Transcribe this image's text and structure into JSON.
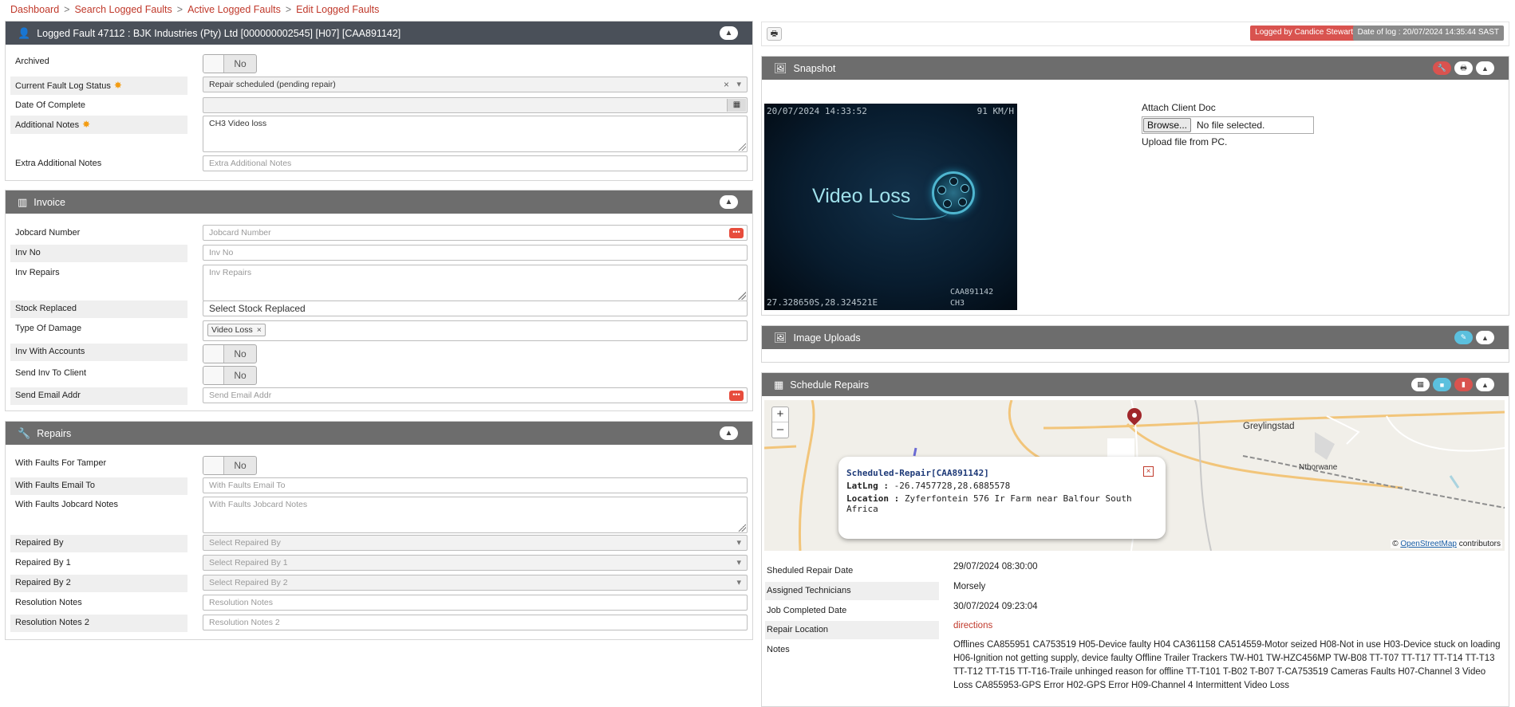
{
  "breadcrumb": [
    "Dashboard",
    "Search Logged Faults",
    "Active Logged Faults",
    "Edit Logged Faults"
  ],
  "breadcrumb_sep": ">",
  "fault": {
    "header_title": "Logged Fault 47112 : BJK Industries (Pty) Ltd [000000002545] [H07] [CAA891142]",
    "archived_label": "Archived",
    "archived_toggle": "No",
    "status_label": "Current Fault Log Status",
    "status_value": "Repair scheduled (pending repair)",
    "clear_glyph": "×",
    "doc_label": "Date Of Complete",
    "notes_label": "Additional Notes",
    "notes_value": "CH3 Video loss",
    "extra_label": "Extra Additional Notes",
    "extra_placeholder": "Extra Additional Notes"
  },
  "invoice": {
    "title": "Invoice",
    "jobcard_label": "Jobcard Number",
    "jobcard_placeholder": "Jobcard Number",
    "invno_label": "Inv No",
    "invno_placeholder": "Inv No",
    "repairs_label": "Inv Repairs",
    "repairs_placeholder": "Inv Repairs",
    "stock_label": "Stock Replaced",
    "stock_value": "Select Stock Replaced",
    "damage_label": "Type Of Damage",
    "damage_tag": "Video Loss",
    "accounts_label": "Inv With Accounts",
    "accounts_toggle": "No",
    "send_label": "Send Inv To Client",
    "send_toggle": "No",
    "email_label": "Send Email Addr",
    "email_placeholder": "Send Email Addr"
  },
  "repairs": {
    "title": "Repairs",
    "tamper_label": "With Faults For Tamper",
    "tamper_toggle": "No",
    "email_to_label": "With Faults Email To",
    "email_to_placeholder": "With Faults Email To",
    "jobcard_notes_label": "With Faults Jobcard Notes",
    "jobcard_notes_placeholder": "With Faults Jobcard Notes",
    "by_label": "Repaired By",
    "by_placeholder": "Select Repaired By",
    "by1_label": "Repaired By 1",
    "by1_placeholder": "Select Repaired By 1",
    "by2_label": "Repaired By 2",
    "by2_placeholder": "Select Repaired By 2",
    "res_label": "Resolution Notes",
    "res_placeholder": "Resolution Notes",
    "res2_label": "Resolution Notes 2",
    "res2_placeholder": "Resolution Notes 2"
  },
  "topbar": {
    "logged_by": "Logged by Candice Stewart",
    "date_of_log": "Date of log : 20/07/2024 14:35:44 SAST"
  },
  "snapshot": {
    "title": "Snapshot",
    "timestamp": "20/07/2024 14:33:52",
    "speed": "91 KM/H",
    "overlay_text": "Video Loss",
    "gps": "27.328650S,28.324521E",
    "camera_id": "CAA891142",
    "channel": "CH3",
    "attach_label": "Attach Client Doc",
    "browse_label": "Browse...",
    "file_status": "No file selected.",
    "upload_label": "Upload file from PC."
  },
  "image_uploads": {
    "title": "Image Uploads"
  },
  "schedule": {
    "title": "Schedule Repairs",
    "zoom_in": "+",
    "zoom_out": "–",
    "town1": "Greylingstad",
    "town2": "Nthorwane",
    "popup_title": "Scheduled-Repair[CAA891142]",
    "popup_latlng_label": "LatLng :",
    "popup_latlng": "-26.7457728,28.6885578",
    "popup_location_label": "Location :",
    "popup_location": "Zyferfontein 576 Ir Farm near Balfour South Africa",
    "popup_close": "×",
    "attribution_prefix": "©",
    "attribution_link": "OpenStreetMap",
    "attribution_suffix": "contributors",
    "date_label": "Sheduled Repair Date",
    "date_value": "29/07/2024 08:30:00",
    "tech_label": "Assigned Technicians",
    "tech_value": "Morsely",
    "completed_label": "Job Completed Date",
    "completed_value": "30/07/2024 09:23:04",
    "location_label": "Repair Location",
    "location_value": "directions",
    "notes_label": "Notes",
    "notes_value": "Offlines CA855951 CA753519 H05-Device faulty H04 CA361158 CA514559-Motor seized H08-Not in use H03-Device stuck on loading H06-Ignition not getting supply, device faulty Offline Trailer Trackers TW-H01 TW-HZC456MP TW-B08 TT-T07 TT-T17 TT-T14 TT-T13 TT-T12 TT-T15 TT-T16-Traile unhinged reason for offline TT-T101 T-B02 T-B07 T-CA753519 Cameras Faults H07-Channel 3 Video Loss CA855953-GPS Error H02-GPS Error H09-Channel 4 Intermittent Video Loss"
  },
  "icons": {
    "user": "👤",
    "invoice": "▥",
    "wrench": "🔧",
    "print": "🖶",
    "image": "🖼",
    "calendar": "▦",
    "chevron_up": "▲",
    "edit": "✎",
    "camera": "▮",
    "video": "■",
    "dots": "•••"
  },
  "colors": {
    "accent_red": "#c0392b",
    "header_dark": "#4a5059",
    "header_gray": "#6d6d6d",
    "required_star": "#f39c12"
  }
}
